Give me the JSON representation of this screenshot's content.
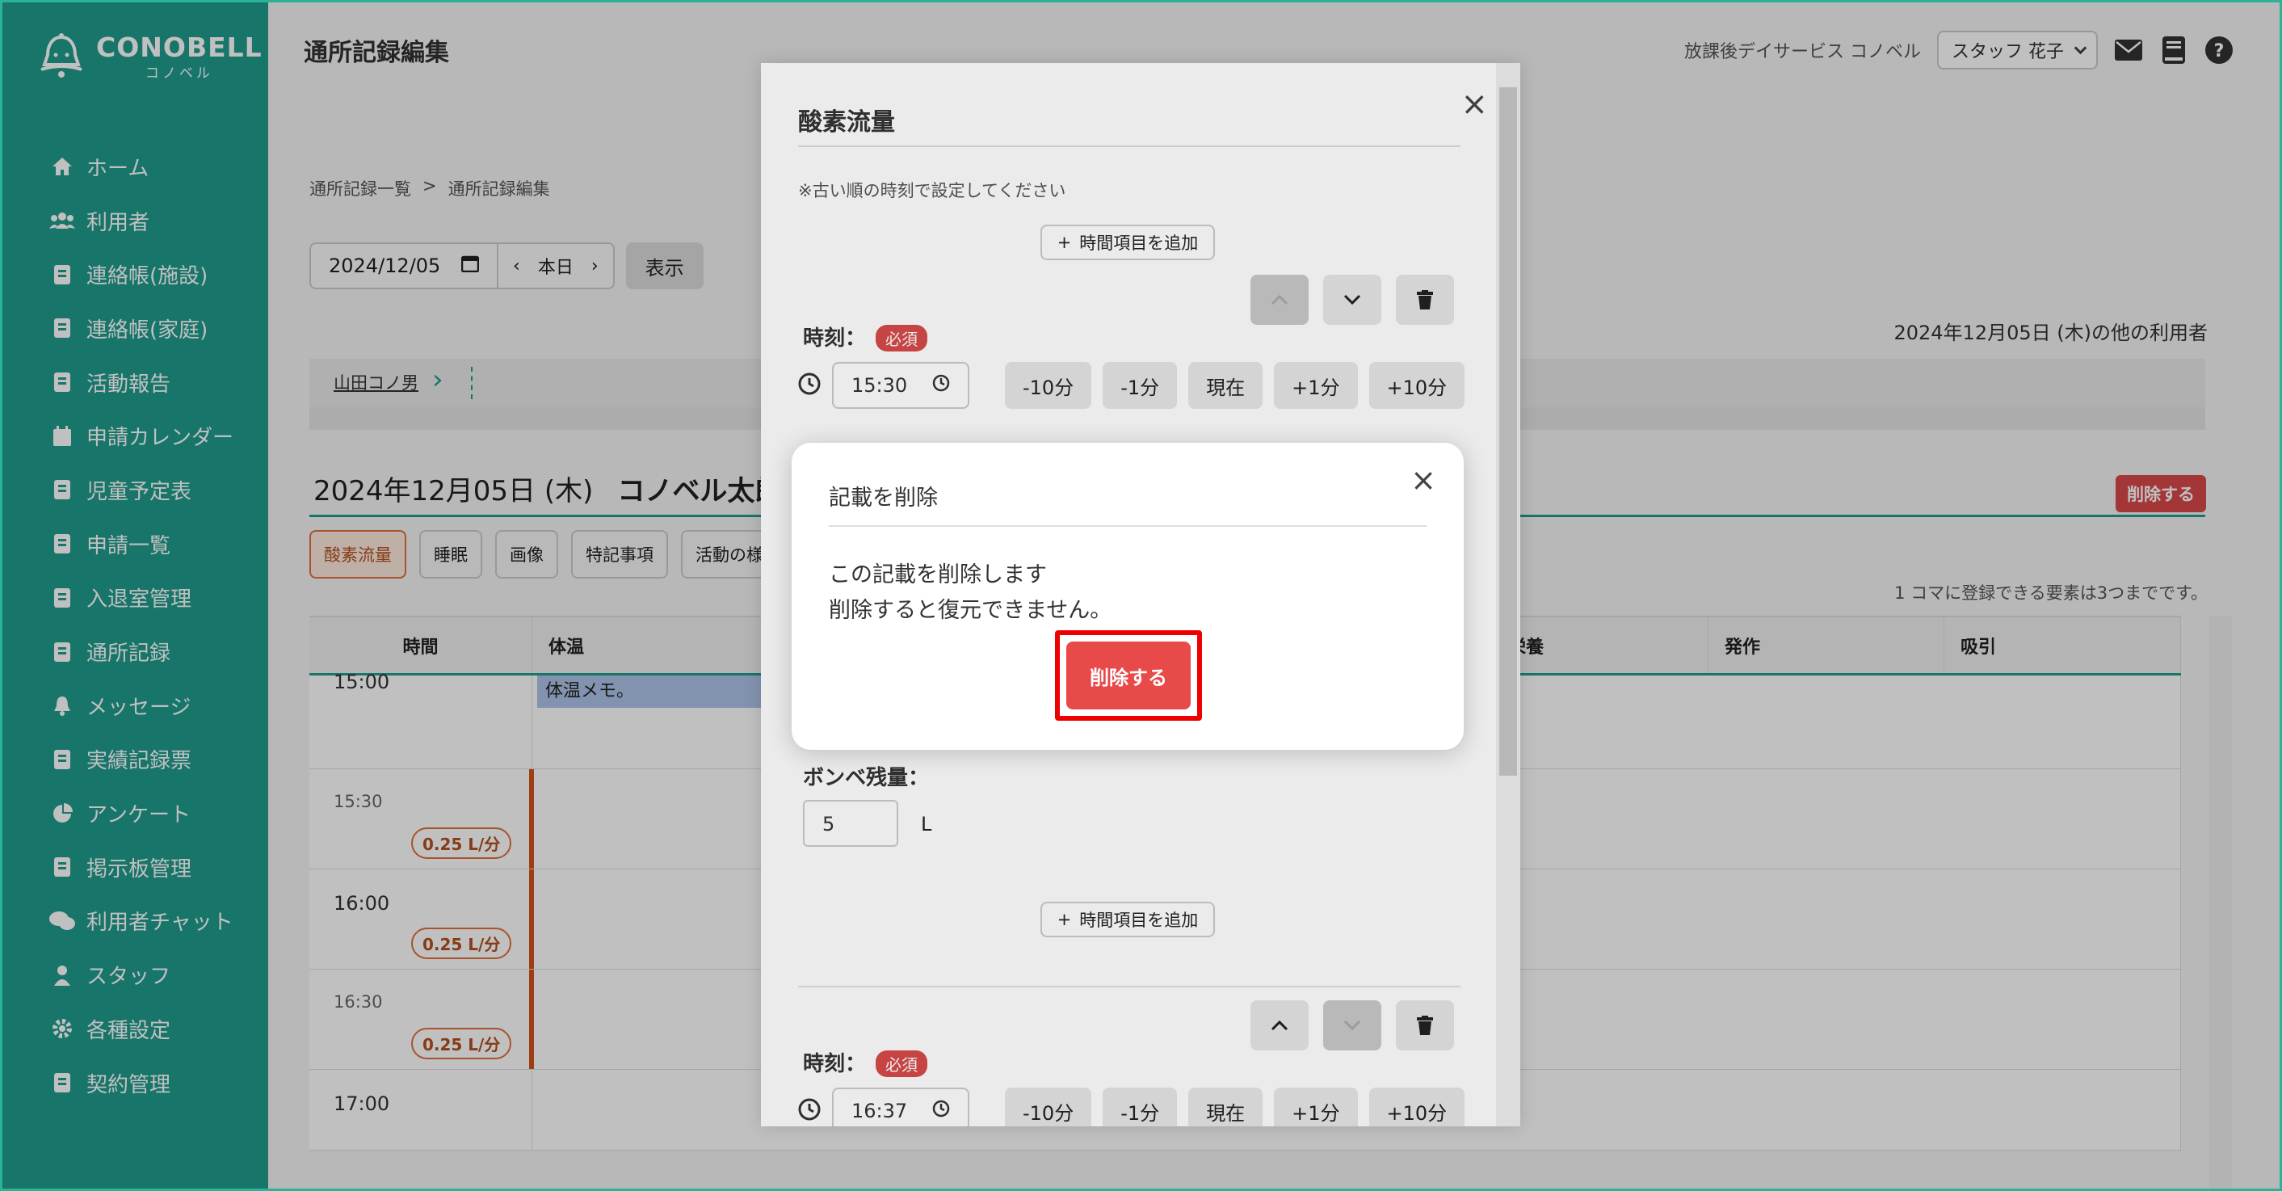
{
  "app": {
    "logo_main": "CONOBELL",
    "logo_sub": "コノベル"
  },
  "sidebar": {
    "items": [
      {
        "label": "ホーム",
        "icon": "home-icon"
      },
      {
        "label": "利用者",
        "icon": "users-icon"
      },
      {
        "label": "連絡帳(施設)",
        "icon": "contact-book-icon"
      },
      {
        "label": "連絡帳(家庭)",
        "icon": "contact-book-icon"
      },
      {
        "label": "活動報告",
        "icon": "report-icon"
      },
      {
        "label": "申請カレンダー",
        "icon": "calendar-icon"
      },
      {
        "label": "児童予定表",
        "icon": "schedule-icon"
      },
      {
        "label": "申請一覧",
        "icon": "list-icon"
      },
      {
        "label": "入退室管理",
        "icon": "door-icon"
      },
      {
        "label": "通所記録",
        "icon": "record-icon"
      },
      {
        "label": "メッセージ",
        "icon": "bell-icon"
      },
      {
        "label": "実績記録票",
        "icon": "table-icon"
      },
      {
        "label": "アンケート",
        "icon": "pie-icon"
      },
      {
        "label": "掲示板管理",
        "icon": "board-icon"
      },
      {
        "label": "利用者チャット",
        "icon": "chat-icon"
      },
      {
        "label": "スタッフ",
        "icon": "staff-icon"
      },
      {
        "label": "各種設定",
        "icon": "gear-icon"
      },
      {
        "label": "契約管理",
        "icon": "contract-icon"
      }
    ]
  },
  "header": {
    "title": "通所記録編集",
    "facility": "放課後デイサービス コノベル",
    "staff": "スタッフ 花子"
  },
  "breadcrumb": {
    "item1": "通所記録一覧",
    "sep": ">",
    "item2": "通所記録編集"
  },
  "date_nav": {
    "date": "2024/12/05",
    "today": "本日",
    "show": "表示",
    "other_users": "2024年12月05日 (木)の他の利用者"
  },
  "strip": {
    "user": "山田コノ男"
  },
  "record": {
    "date": "2024年12月05日 (木)",
    "name": "コノベル太郎",
    "delete": "削除する",
    "capacity": "1 コマに登録できる要素は3つまでです。"
  },
  "chips": [
    "酸素流量",
    "睡眠",
    "画像",
    "特記事項",
    "活動の様"
  ],
  "table": {
    "headers": [
      "時間",
      "体温",
      "",
      "",
      "",
      "・栄養",
      "発作",
      "吸引"
    ],
    "rows": [
      {
        "time": "15:00",
        "memo": "体温メモ。",
        "badge": ""
      },
      {
        "time": "15:30",
        "badge": "0.25 L/分",
        "small": true
      },
      {
        "time": "16:00",
        "badge": "0.25 L/分"
      },
      {
        "time": "16:30",
        "badge": "0.25 L/分",
        "small": true
      },
      {
        "time": "17:00",
        "badge": ""
      }
    ]
  },
  "modal": {
    "title": "酸素流量",
    "note": "※古い順の時刻で設定してください",
    "add_time": "時間項目を追加",
    "time_label": "時刻：",
    "required": "必須",
    "time1": "15:30",
    "time2": "16:37",
    "adj": [
      "-10分",
      "-1分",
      "現在",
      "+1分",
      "+10分"
    ],
    "bombe_label": "ボンベ残量：",
    "bombe_value": "5",
    "bombe_unit": "L"
  },
  "dialog": {
    "title": "記載を削除",
    "line1": "この記載を削除します",
    "line2": "削除すると復元できません。",
    "confirm": "削除する"
  },
  "colors": {
    "brand": "#1f9c8e",
    "danger": "#e84a4a",
    "accent": "#e0703a"
  }
}
